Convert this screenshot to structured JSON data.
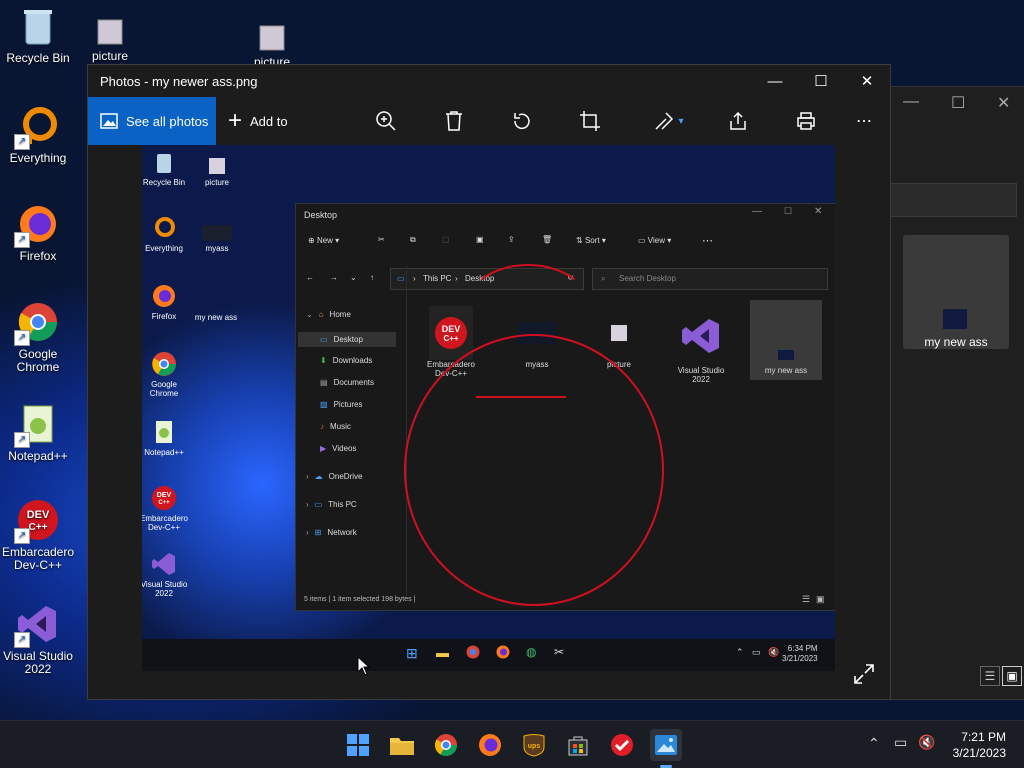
{
  "desktop": {
    "icons": [
      {
        "label": "Recycle Bin"
      },
      {
        "label": "picture"
      },
      {
        "label": "picture"
      },
      {
        "label": "Everything"
      },
      {
        "label": "Firefox"
      },
      {
        "label": "Google Chrome"
      },
      {
        "label": "Notepad++"
      },
      {
        "label": "Embarcadero Dev-C++"
      },
      {
        "label": "Visual Studio 2022"
      }
    ]
  },
  "bg_window": {
    "thumb_label": "my new ass"
  },
  "photos": {
    "title": "Photos - my newer ass.png",
    "see_all": "See all photos",
    "add_to": "Add to"
  },
  "inner": {
    "icons": [
      {
        "label": "Recycle Bin"
      },
      {
        "label": "picture"
      },
      {
        "label": "Everything"
      },
      {
        "label": "myass"
      },
      {
        "label": "Firefox"
      },
      {
        "label": "my new ass"
      },
      {
        "label": "Google Chrome"
      },
      {
        "label": "Notepad++"
      },
      {
        "label": "Embarcadero Dev-C++"
      },
      {
        "label": "Visual Studio 2022"
      }
    ],
    "explorer": {
      "title": "Desktop",
      "new": "New",
      "sort": "Sort",
      "view": "View",
      "breadcrumb_1": "This PC",
      "breadcrumb_2": "Desktop",
      "search_placeholder": "Search Desktop",
      "nav": [
        "Home",
        "Desktop",
        "Downloads",
        "Documents",
        "Pictures",
        "Music",
        "Videos",
        "OneDrive",
        "This PC",
        "Network"
      ],
      "files": [
        "Embarcadero Dev-C++",
        "myass",
        "picture",
        "Visual Studio 2022",
        "my new ass"
      ],
      "status": "5 items  |  1 item selected  198 bytes  |"
    },
    "clock_time": "6:34 PM",
    "clock_date": "3/21/2023"
  },
  "taskbar": {
    "time": "7:21 PM",
    "date": "3/21/2023"
  }
}
